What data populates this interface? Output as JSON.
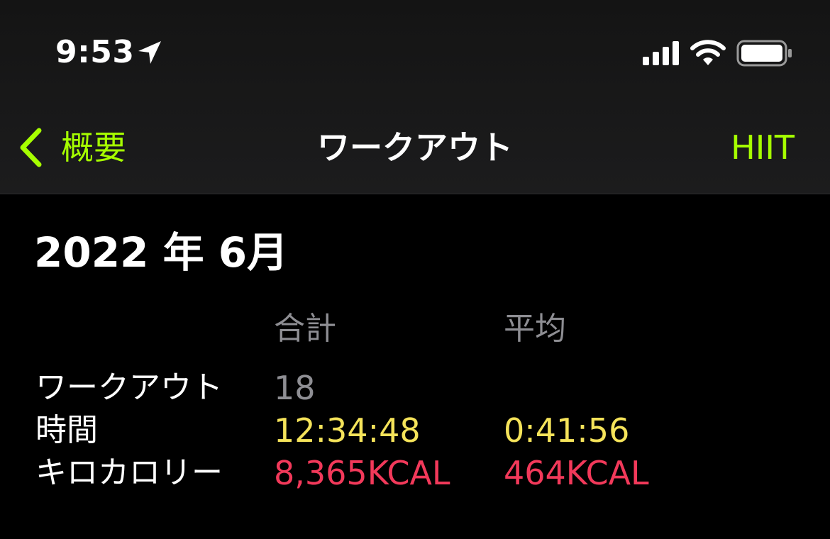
{
  "status_bar": {
    "time": "9:53",
    "location_icon": "location-arrow-icon",
    "signal_icon": "cellular-signal-icon",
    "wifi_icon": "wifi-icon",
    "battery_icon": "battery-icon"
  },
  "nav": {
    "back_label": "概要",
    "title": "ワークアウト",
    "right_label": "HIIT",
    "accent_color": "#a6ff00"
  },
  "content": {
    "month_title": "2022 年 6月",
    "columns": {
      "total": "合計",
      "average": "平均"
    },
    "rows": [
      {
        "label": "ワークアウト",
        "total": "18",
        "average": ""
      },
      {
        "label": "時間",
        "total": "12:34:48",
        "average": "0:41:56"
      },
      {
        "label": "キロカロリー",
        "total": "8,365KCAL",
        "average": "464KCAL"
      }
    ],
    "colors": {
      "count": "#8e8e93",
      "time": "#f5e35a",
      "calories": "#f2395a"
    }
  }
}
